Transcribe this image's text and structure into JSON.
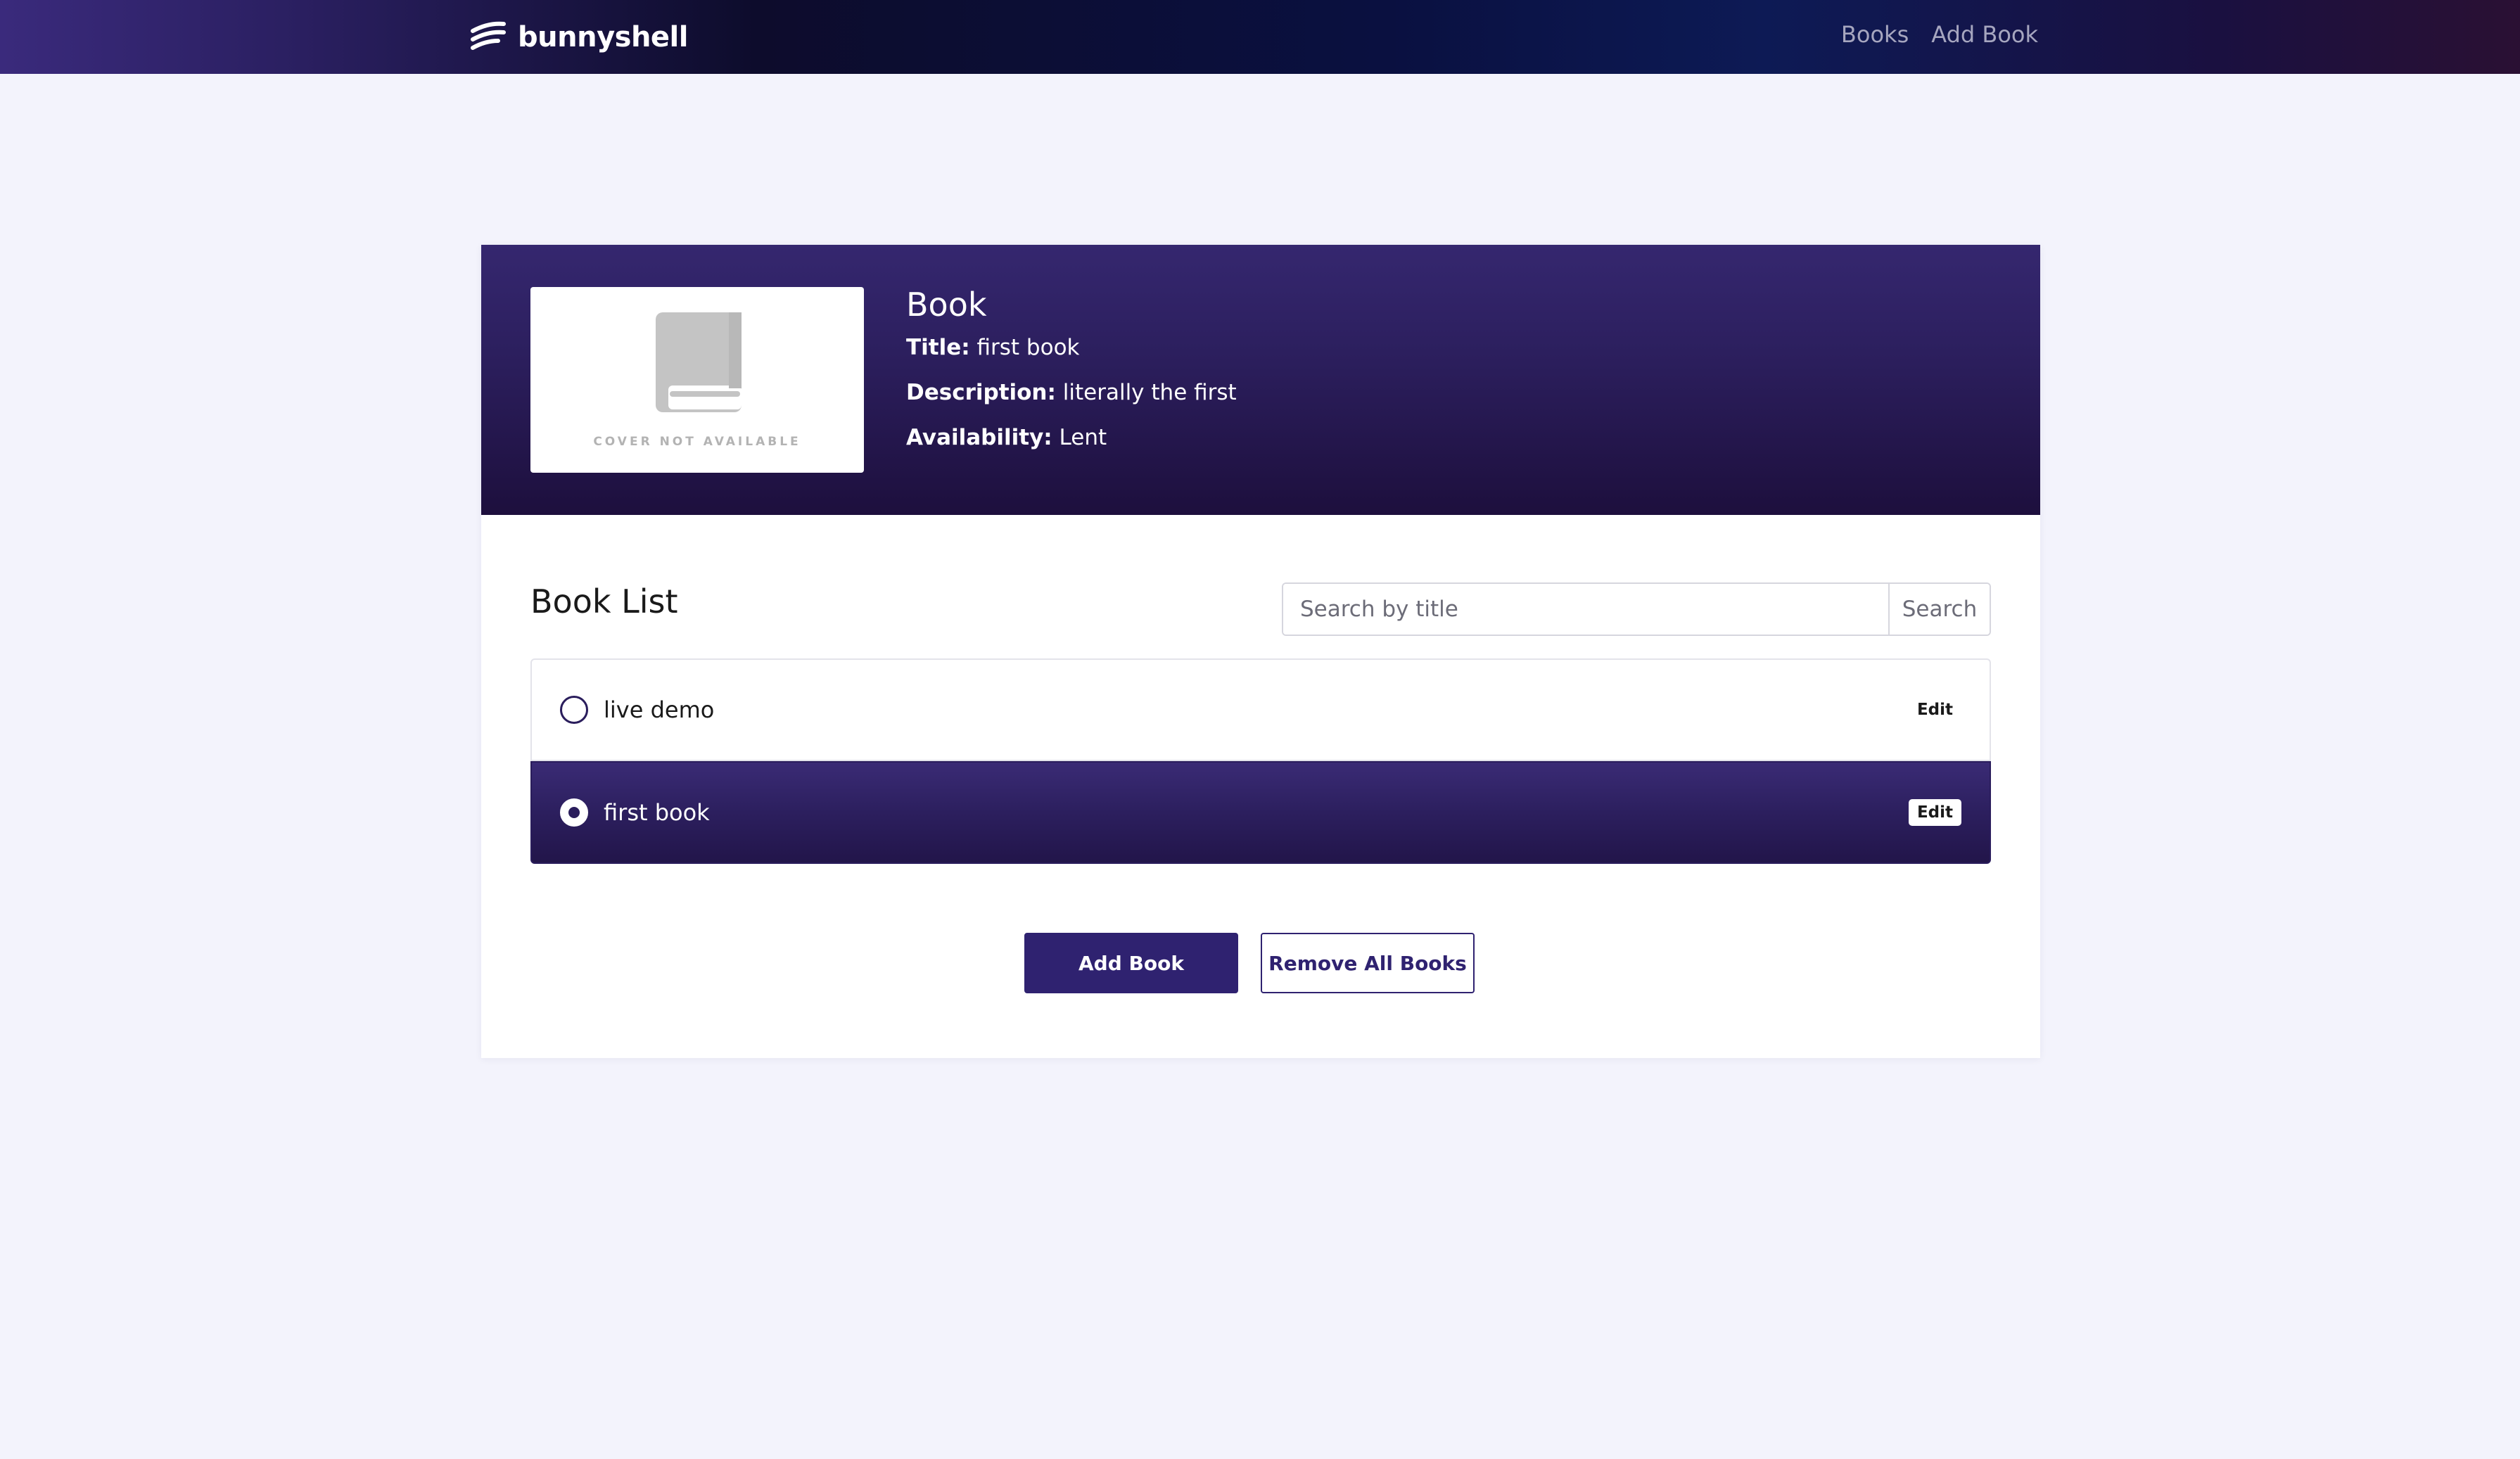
{
  "navbar": {
    "brand": "bunnyshell",
    "links": [
      "Books",
      "Add Book"
    ]
  },
  "book_detail": {
    "heading": "Book",
    "cover_placeholder": "COVER NOT AVAILABLE",
    "title_label": "Title:",
    "title_value": "first book",
    "description_label": "Description:",
    "description_value": "literally the first",
    "availability_label": "Availability:",
    "availability_value": "Lent"
  },
  "book_list": {
    "heading": "Book List",
    "search": {
      "placeholder": "Search by title",
      "value": "",
      "button_label": "Search"
    },
    "items": [
      {
        "title": "live demo",
        "edit_label": "Edit",
        "selected": false
      },
      {
        "title": "first book",
        "edit_label": "Edit",
        "selected": true
      }
    ]
  },
  "actions": {
    "add_label": "Add Book",
    "remove_all_label": "Remove All Books"
  },
  "colors": {
    "accent": "#2f2270",
    "page_background": "#f3f3fc",
    "hero_top": "#35276f",
    "hero_bottom": "#1d0f3d"
  },
  "icons": [
    "bunnyshell-logo-icon",
    "book-icon"
  ]
}
